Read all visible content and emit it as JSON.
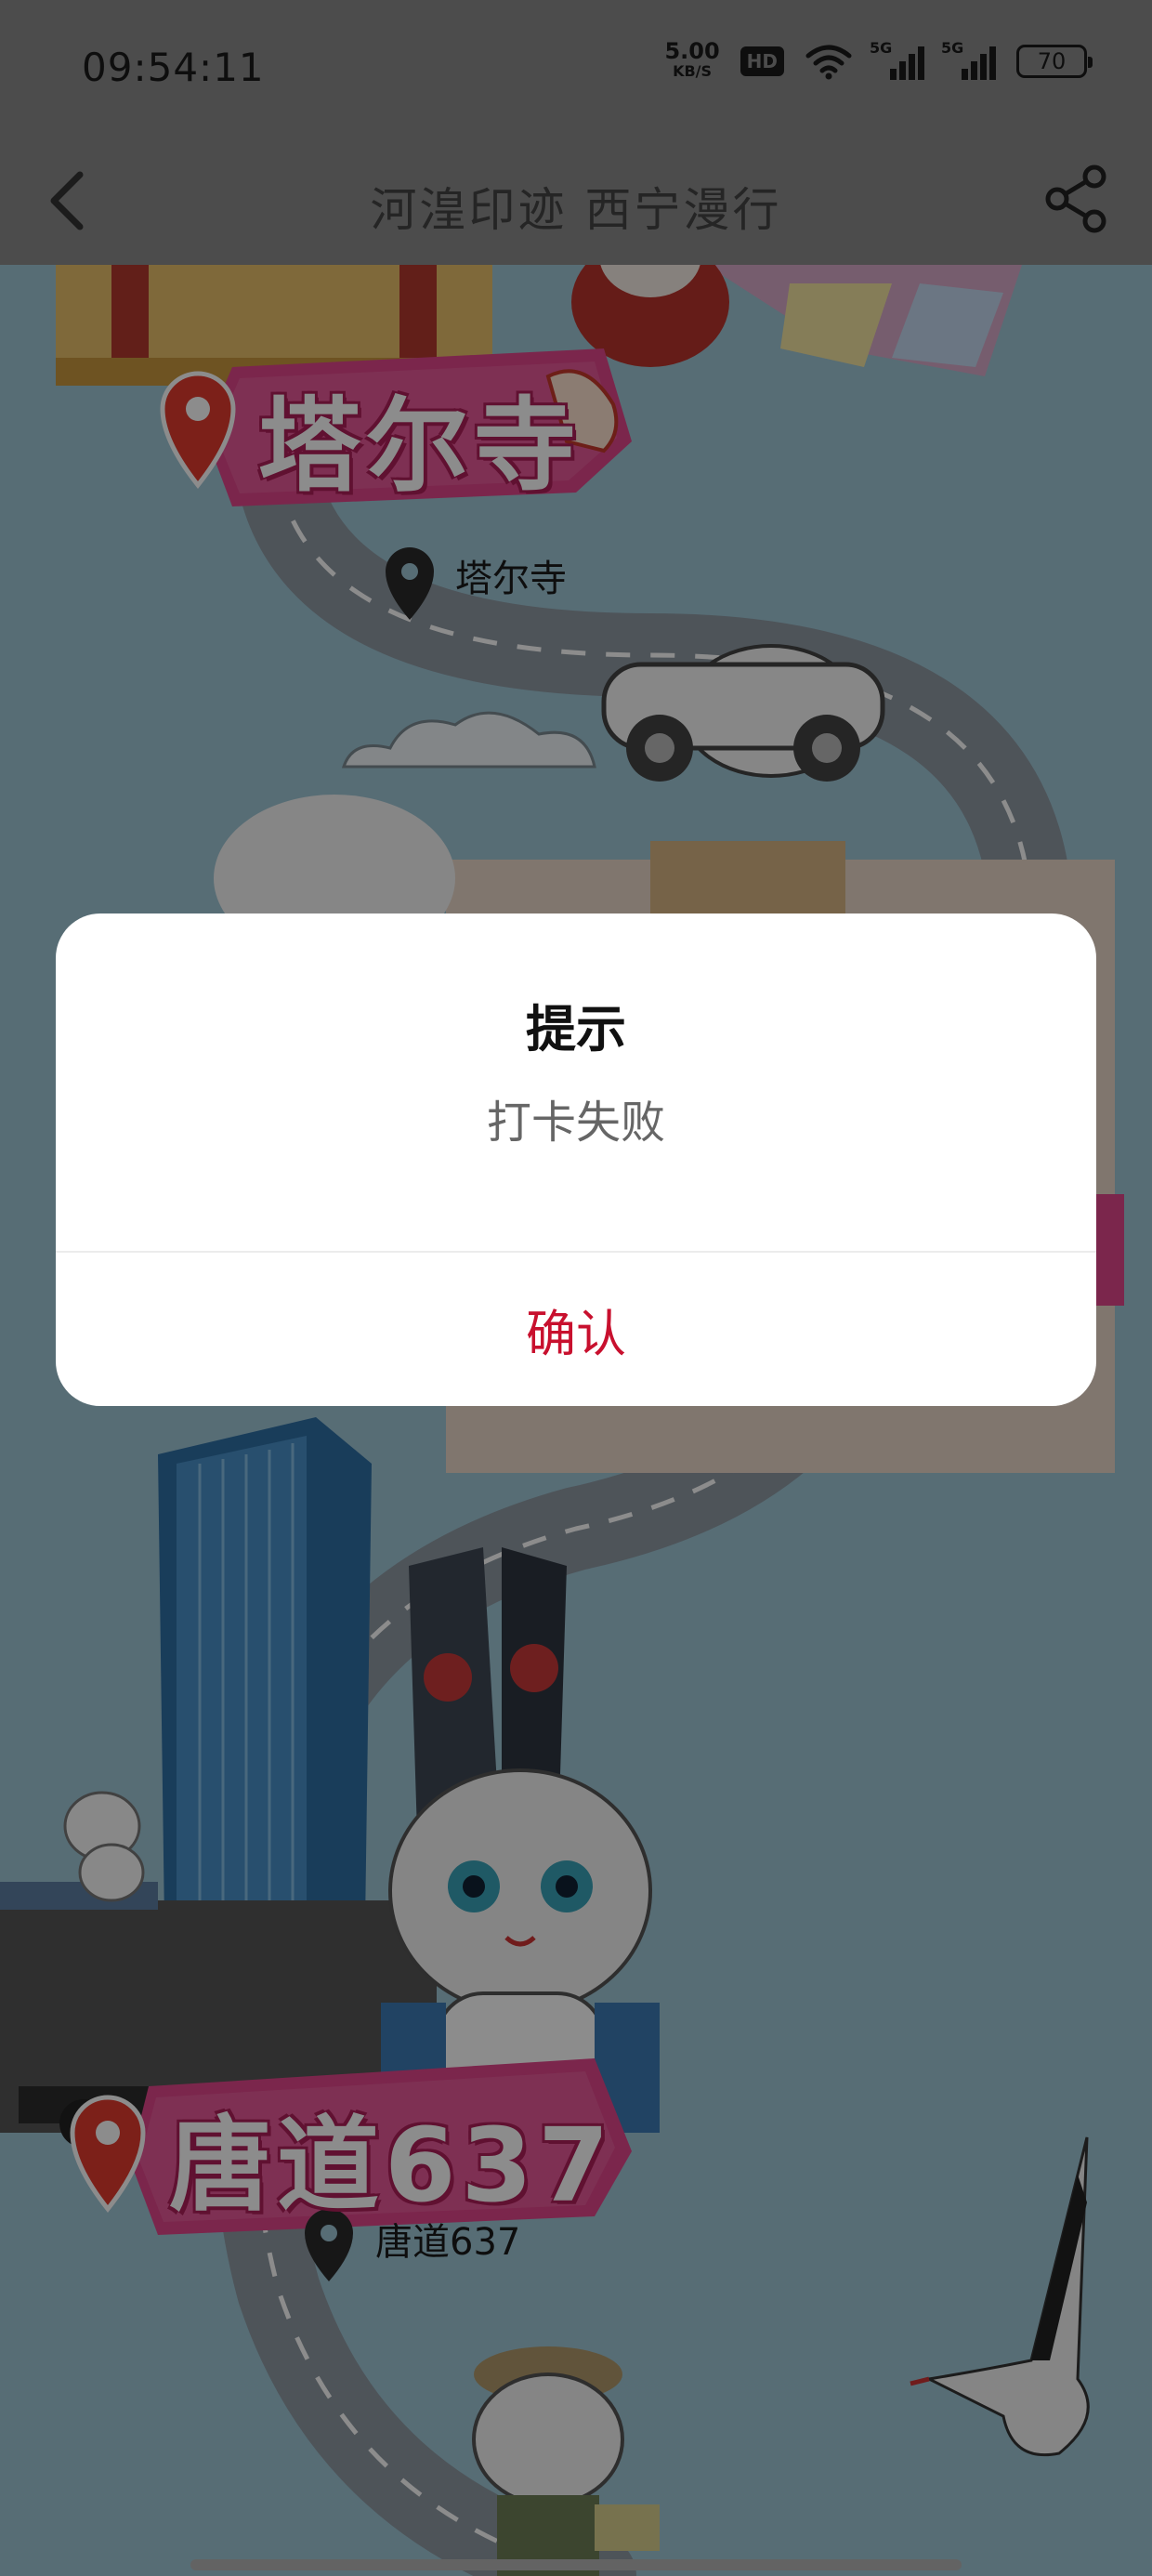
{
  "status_bar": {
    "time": "09:54:11",
    "net_speed_value": "5.00",
    "net_speed_unit": "KB/S",
    "hd_label": "HD",
    "signal_1_label": "5G",
    "signal_2_label": "5G",
    "battery_level": "70"
  },
  "nav": {
    "title": "河湟印迹 西宁漫行",
    "back_icon": "chevron-left-icon",
    "share_icon": "share-icon"
  },
  "map": {
    "landmarks": [
      {
        "banner": "塔尔寺",
        "label": "塔尔寺"
      },
      {
        "banner": "唐道637",
        "label": "唐道637"
      }
    ],
    "colors": {
      "banner_pink": "#e0468a",
      "pin_red": "#e23b2e",
      "road": "#8e9aa3",
      "sky": "#9fc6d6"
    }
  },
  "dialog": {
    "title": "提示",
    "message": "打卡失败",
    "confirm_label": "确认",
    "confirm_color": "#c8102e"
  }
}
